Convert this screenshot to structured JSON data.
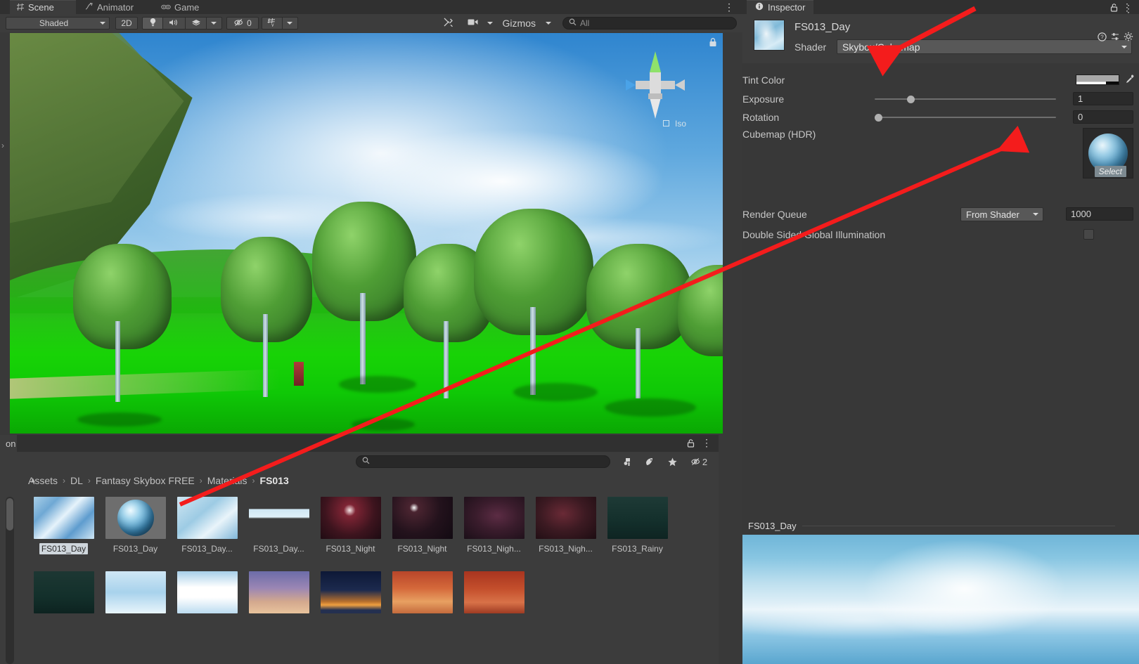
{
  "scene_panel": {
    "tabs": [
      {
        "label": "Scene",
        "icon": "grid-icon",
        "active": true
      },
      {
        "label": "Animator",
        "icon": "animator-icon",
        "active": false
      },
      {
        "label": "Game",
        "icon": "gamepad-icon",
        "active": false
      }
    ],
    "menu_icon": "kebab-menu-icon",
    "toolbar": {
      "draw_mode": "Shaded",
      "mode_2d": "2D",
      "lighting_icon": "lightbulb-icon",
      "audio_icon": "speaker-icon",
      "fx_icon": "effects-icon",
      "hidden_objects_count": "0",
      "hidden_icon": "eye-slash-icon",
      "grid_icon": "grid-axis-icon",
      "tools_icon": "tools-icon",
      "camera_icon": "camera-icon",
      "gizmos": "Gizmos",
      "search_placeholder": "All",
      "search_icon": "search-icon"
    },
    "overlay": {
      "iso_label": "Iso",
      "lock_icon": "lock-icon",
      "gizmo_icon": "scene-orientation-gizmo"
    }
  },
  "project_panel": {
    "tab_label": "on",
    "lock_icon": "lock-icon",
    "menu_icon": "kebab-menu-icon",
    "search_placeholder": "",
    "search_icon": "search-icon",
    "filter_buttons": [
      {
        "name": "favorite-search-icon",
        "glyph": "⚑"
      },
      {
        "name": "type-filter-icon",
        "glyph": "◑"
      },
      {
        "name": "label-filter-icon",
        "glyph": "★"
      },
      {
        "name": "hidden-packages-icon",
        "glyph": "⊘"
      }
    ],
    "packages_count": "2",
    "breadcrumb": [
      "Assets",
      "DL",
      "Fantasy Skybox FREE",
      "Materials",
      "FS013"
    ],
    "breadcrumb_separator": "›",
    "collapse_icon": "triangle-up-icon",
    "grid_rows": [
      [
        {
          "label": "FS013_Day",
          "selected": true,
          "thumb": "day-clouds-bright"
        },
        {
          "label": "FS013_Day",
          "selected": false,
          "thumb": "sphere-cubemap"
        },
        {
          "label": "FS013_Day...",
          "selected": false,
          "thumb": "day-clouds-pale"
        },
        {
          "label": "FS013_Day...",
          "selected": false,
          "thumb": "day-thin-strip"
        },
        {
          "label": "FS013_Night",
          "selected": false,
          "thumb": "night-red-star"
        },
        {
          "label": "FS013_Night",
          "selected": false,
          "thumb": "night-dark-star"
        },
        {
          "label": "FS013_Nigh...",
          "selected": false,
          "thumb": "night-purple"
        },
        {
          "label": "FS013_Nigh...",
          "selected": false,
          "thumb": "night-maroon"
        },
        {
          "label": "FS013_Rainy",
          "selected": false,
          "thumb": "rainy-teal"
        }
      ],
      [
        {
          "label": "",
          "selected": false,
          "thumb": "rainy-dark-teal"
        },
        {
          "label": "",
          "selected": false,
          "thumb": "sky-soft-blue"
        },
        {
          "label": "",
          "selected": false,
          "thumb": "sky-white-band"
        },
        {
          "label": "",
          "selected": false,
          "thumb": "sunset-violet"
        },
        {
          "label": "",
          "selected": false,
          "thumb": "sunset-dark-sun"
        },
        {
          "label": "",
          "selected": false,
          "thumb": "sunset-orange"
        },
        {
          "label": "",
          "selected": false,
          "thumb": "sunset-red"
        }
      ]
    ]
  },
  "inspector": {
    "tab_label": "Inspector",
    "tab_icon": "info-icon",
    "lock_icon": "lock-icon",
    "menu_icon": "kebab-menu-icon",
    "material_name": "FS013_Day",
    "shader_label": "Shader",
    "shader_value": "Skybox/Cubemap",
    "help_icon": "help-icon",
    "preset_icon": "preset-icon",
    "settings_icon": "gear-icon",
    "properties": [
      {
        "label": "Tint Color",
        "type": "color",
        "eyedropper_icon": "eyedropper-icon"
      },
      {
        "label": "Exposure",
        "type": "slider",
        "value": "1",
        "knob_pct": 18
      },
      {
        "label": "Rotation",
        "type": "slider",
        "value": "0",
        "knob_pct": 0
      },
      {
        "label": "Cubemap   (HDR)",
        "type": "object",
        "select_label": "Select"
      }
    ],
    "render_queue_label": "Render Queue",
    "render_queue_mode": "From Shader",
    "render_queue_value": "1000",
    "double_sided_label": "Double Sided Global Illumination",
    "double_sided_checked": false
  },
  "preview": {
    "name": "FS013_Day",
    "menu_icon": "kebab-menu-icon"
  },
  "colors": {
    "annotation_red": "#f41c1c",
    "panel_bg": "#383838",
    "toolbar_bg": "#3c3c3c",
    "tabbar_bg": "#303030",
    "text": "#c8c8c8",
    "field_bg": "#2a2a2a",
    "enum_bg": "#585858"
  }
}
